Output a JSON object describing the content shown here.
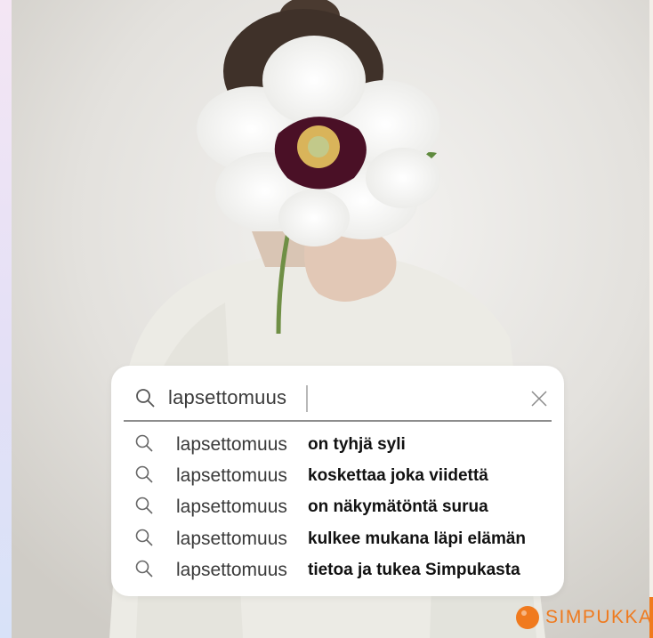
{
  "search": {
    "query": "lapsettomuus",
    "icon": "search-icon",
    "clear_icon": "close-icon"
  },
  "suggestions": [
    {
      "base": "lapsettomuus",
      "completion": "on tyhjä syli"
    },
    {
      "base": "lapsettomuus",
      "completion": "koskettaa joka viidettä"
    },
    {
      "base": "lapsettomuus",
      "completion": "on näkymätöntä surua"
    },
    {
      "base": "lapsettomuus",
      "completion": "kulkee mukana läpi elämän"
    },
    {
      "base": "lapsettomuus",
      "completion": "tietoa ja tukea Simpukasta"
    }
  ],
  "brand": {
    "name": "SIMPUKKA",
    "color": "#ef7a1e"
  }
}
